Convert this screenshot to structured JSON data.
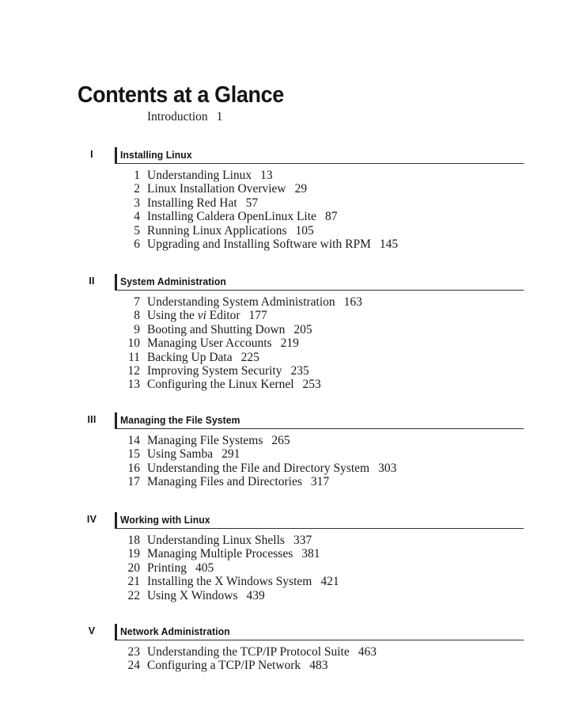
{
  "page": {
    "title": "Contents at a Glance",
    "background_color": "#ffffff",
    "text_color": "#1a1a1a",
    "rule_color": "#303030"
  },
  "frontmatter": [
    {
      "label": "Introduction",
      "page": "1"
    }
  ],
  "parts": [
    {
      "numeral": "I",
      "title": "Installing Linux",
      "chapters": [
        {
          "num": "1",
          "title": "Understanding Linux",
          "page": "13"
        },
        {
          "num": "2",
          "title": "Linux Installation Overview",
          "page": "29"
        },
        {
          "num": "3",
          "title": "Installing Red Hat",
          "page": "57"
        },
        {
          "num": "4",
          "title": "Installing Caldera OpenLinux Lite",
          "page": "87"
        },
        {
          "num": "5",
          "title": "Running Linux Applications",
          "page": "105"
        },
        {
          "num": "6",
          "title": "Upgrading and Installing Software with RPM",
          "page": "145"
        }
      ]
    },
    {
      "numeral": "II",
      "title": "System Administration",
      "chapters": [
        {
          "num": "7",
          "title": "Understanding System Administration",
          "page": "163"
        },
        {
          "num": "8",
          "title": "Using the vi Editor",
          "title_pre": "Using the ",
          "title_italic": "vi",
          "title_post": " Editor",
          "page": "177"
        },
        {
          "num": "9",
          "title": "Booting and Shutting Down",
          "page": "205"
        },
        {
          "num": "10",
          "title": "Managing User Accounts",
          "page": "219"
        },
        {
          "num": "11",
          "title": "Backing Up Data",
          "page": "225"
        },
        {
          "num": "12",
          "title": "Improving System Security",
          "page": "235"
        },
        {
          "num": "13",
          "title": "Configuring the Linux Kernel",
          "page": "253"
        }
      ]
    },
    {
      "numeral": "III",
      "title": "Managing the File System",
      "chapters": [
        {
          "num": "14",
          "title": "Managing File Systems",
          "page": "265"
        },
        {
          "num": "15",
          "title": "Using Samba",
          "page": "291"
        },
        {
          "num": "16",
          "title": "Understanding the File and Directory System",
          "page": "303"
        },
        {
          "num": "17",
          "title": "Managing Files and Directories",
          "page": "317"
        }
      ]
    },
    {
      "numeral": "IV",
      "title": "Working with Linux",
      "chapters": [
        {
          "num": "18",
          "title": "Understanding Linux Shells",
          "page": "337"
        },
        {
          "num": "19",
          "title": "Managing Multiple Processes",
          "page": "381"
        },
        {
          "num": "20",
          "title": "Printing",
          "page": "405"
        },
        {
          "num": "21",
          "title": "Installing the X Windows System",
          "page": "421"
        },
        {
          "num": "22",
          "title": "Using X Windows",
          "page": "439"
        }
      ]
    },
    {
      "numeral": "V",
      "title": "Network Administration",
      "chapters": [
        {
          "num": "23",
          "title": "Understanding the TCP/IP Protocol Suite",
          "page": "463"
        },
        {
          "num": "24",
          "title": "Configuring a TCP/IP Network",
          "page": "483"
        }
      ]
    }
  ],
  "layout": {
    "part_tops": [
      186,
      346,
      521,
      647,
      788
    ]
  }
}
